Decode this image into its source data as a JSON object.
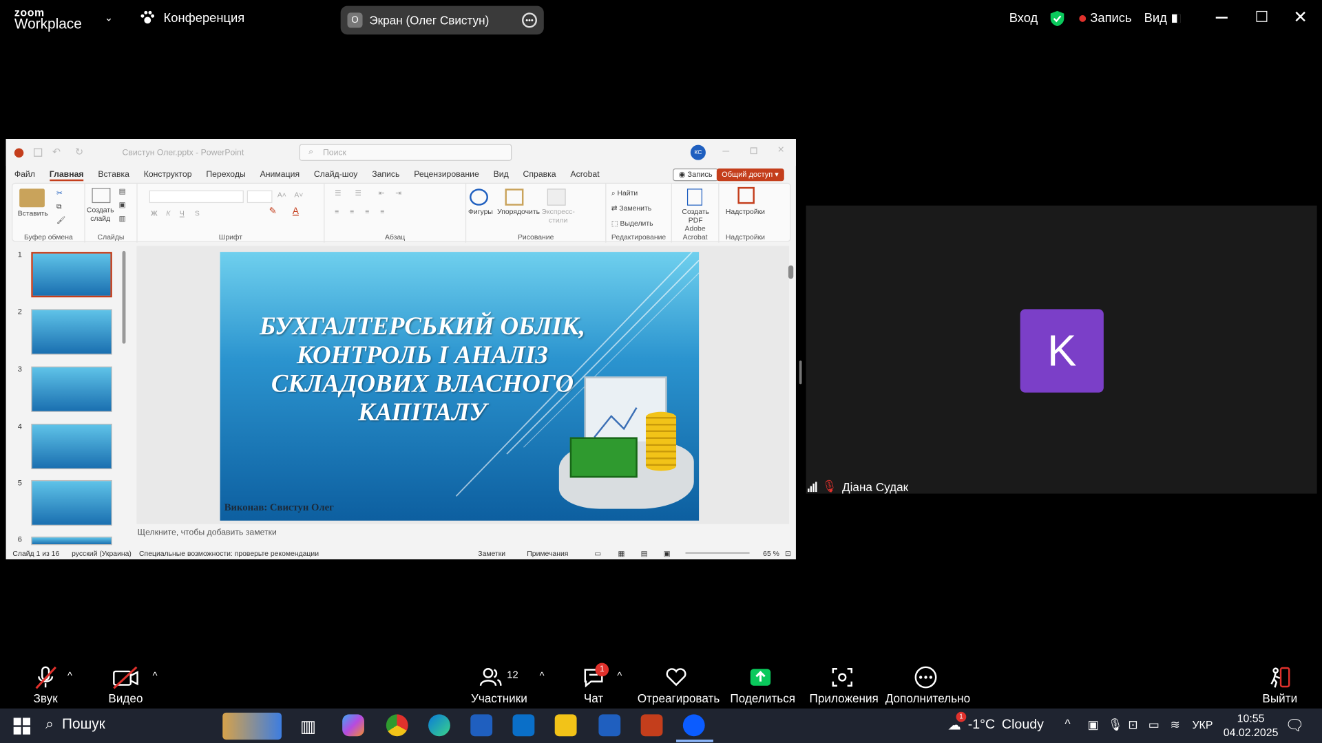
{
  "zoom": {
    "logo_top": "zoom",
    "logo_bottom": "Workplace",
    "meeting_label": "Конференция",
    "share_initial": "О",
    "share_title": "Экран (Олег Свистун)",
    "signin": "Вход",
    "recording": "Запись",
    "view": "Вид"
  },
  "ppt": {
    "filename": "Свистун Олег.pptx - PowerPoint",
    "search_placeholder": "Поиск",
    "user_initials": "КС",
    "tabs": [
      "Файл",
      "Главная",
      "Вставка",
      "Конструктор",
      "Переходы",
      "Анимация",
      "Слайд-шоу",
      "Запись",
      "Рецензирование",
      "Вид",
      "Справка",
      "Acrobat"
    ],
    "record_button": "Запись",
    "share_button": "Общий доступ",
    "groups": {
      "clipboard": "Буфер обмена",
      "slides": "Слайды",
      "font": "Шрифт",
      "paragraph": "Абзац",
      "drawing": "Рисование",
      "editing": "Редактирование",
      "acrobat": "Adobe Acrobat",
      "addins": "Надстройки"
    },
    "ribbon_items": {
      "paste": "Вставить",
      "new_slide_1": "Создать",
      "new_slide_2": "слайд",
      "shapes": "Фигуры",
      "arrange": "Упорядочить",
      "quick_styles_1": "Экспресс-",
      "quick_styles_2": "стили",
      "find": "Найти",
      "replace": "Заменить",
      "select": "Выделить",
      "create_pdf_1": "Создать",
      "create_pdf_2": "PDF",
      "addins": "Надстройки"
    },
    "thumbnails": [
      "1",
      "2",
      "3",
      "4",
      "5",
      "6"
    ],
    "slide_title": "БУХГАЛТЕРСЬКИЙ ОБЛІК, КОНТРОЛЬ І АНАЛІЗ СКЛАДОВИХ ВЛАСНОГО КАПІТАЛУ",
    "slide_author": "Виконав: Свистун Олег",
    "notes_placeholder": "Щелкните, чтобы добавить заметки",
    "status": {
      "slide_of": "Слайд 1 из 16",
      "language": "русский (Украина)",
      "accessibility": "Специальные возможности: проверьте рекомендации",
      "notes": "Заметки",
      "comments": "Примечания",
      "zoom": "65 %"
    }
  },
  "participant": {
    "initial": "K",
    "name": "Діана Судак"
  },
  "toolbar": {
    "audio": "Звук",
    "video": "Видео",
    "participants": "Участники",
    "participants_count": "12",
    "chat": "Чат",
    "chat_badge": "1",
    "react": "Отреагировать",
    "share": "Поделиться",
    "apps": "Приложения",
    "more": "Дополнительно",
    "leave": "Выйти"
  },
  "taskbar": {
    "search": "Пошук",
    "weather_temp": "-1°C",
    "weather_desc": "Cloudy",
    "weather_badge": "1",
    "lang": "УКР",
    "time": "10:55",
    "date": "04.02.2025"
  },
  "colors": {
    "zoom_share_green": "#0ac95c",
    "recording_red": "#e0312c",
    "avatar_purple": "#7b3fc8",
    "ppt_accent": "#c43e1c",
    "chat_badge": "#e0312c"
  }
}
